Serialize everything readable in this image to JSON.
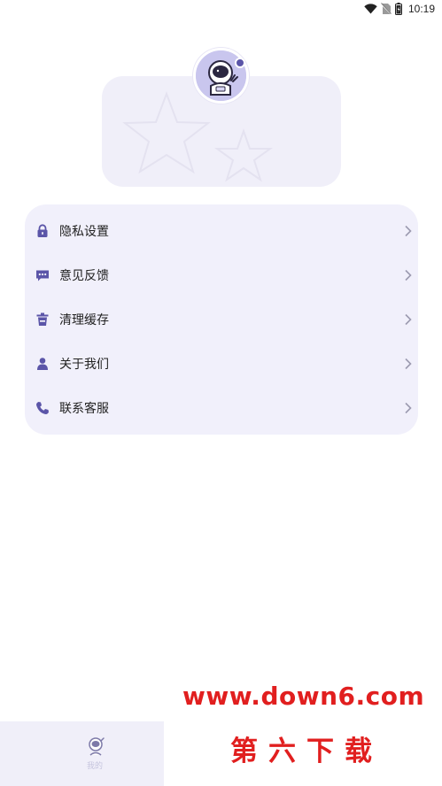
{
  "status_bar": {
    "time": "10:19"
  },
  "colors": {
    "accent": "#5b55a8",
    "card_bg": "#f1f0fb",
    "watermark": "#e11f1f"
  },
  "menu": {
    "items": [
      {
        "label": "隐私设置",
        "icon": "lock-icon"
      },
      {
        "label": "意见反馈",
        "icon": "chat-bubble-icon"
      },
      {
        "label": "清理缓存",
        "icon": "trash-icon"
      },
      {
        "label": "关于我们",
        "icon": "person-icon"
      },
      {
        "label": "联系客服",
        "icon": "phone-icon"
      }
    ]
  },
  "bottom_nav": {
    "label": "我的",
    "icon": "astronaut-icon"
  },
  "watermark": {
    "url": "www.down6.com",
    "name": "第六下载"
  }
}
